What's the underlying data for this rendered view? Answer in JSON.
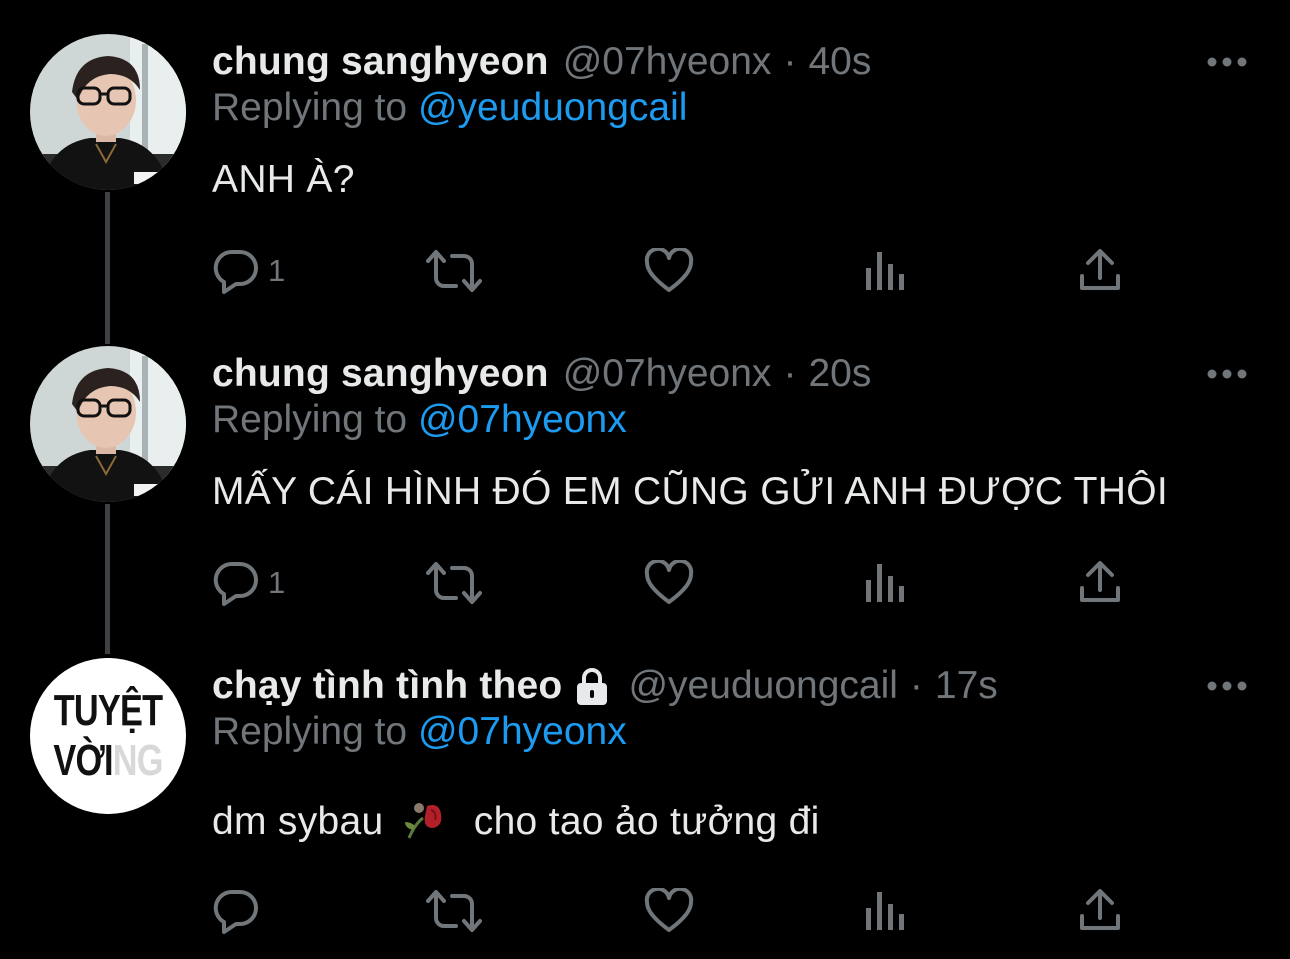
{
  "tweets": [
    {
      "name": "chung sanghyeon",
      "handle": "@07hyeonx",
      "separator": "·",
      "time": "40s",
      "replying_prefix": "Replying to",
      "replying_to": "@yeuduongcail",
      "text": "ANH À?",
      "reply_count": "1",
      "avatar": "photo-avatar",
      "locked": false
    },
    {
      "name": "chung sanghyeon",
      "handle": "@07hyeonx",
      "separator": "·",
      "time": "20s",
      "replying_prefix": "Replying to",
      "replying_to": "@07hyeonx",
      "text": "MẤY CÁI HÌNH ĐÓ EM CŨNG GỬI ANH ĐƯỢC THÔI",
      "reply_count": "1",
      "avatar": "photo-avatar",
      "locked": false
    },
    {
      "name": "chạy tình tình theo",
      "handle": "@yeuduongcail",
      "separator": "·",
      "time": "17s",
      "replying_prefix": "Replying to",
      "replying_to": "@07hyeonx",
      "text_before_emoji": "dm sybau",
      "emoji": "wilted-rose-icon",
      "text_after_emoji": "cho tao ảo tưởng đi",
      "reply_count": "",
      "avatar": "text-avatar",
      "avatar_line1": "TUYỆT",
      "avatar_line2_main": "VỜI",
      "avatar_line2_faded": "NG",
      "locked": true
    }
  ],
  "icons": {
    "reply": "reply-icon",
    "retweet": "retweet-icon",
    "like": "heart-icon",
    "views": "views-icon",
    "share": "share-icon",
    "more": "more-icon",
    "lock": "lock-icon"
  },
  "colors": {
    "background": "#000000",
    "text": "#e7e9ea",
    "secondary": "#71767b",
    "accent": "#1d9bf0",
    "thread_line": "#3e4144"
  }
}
